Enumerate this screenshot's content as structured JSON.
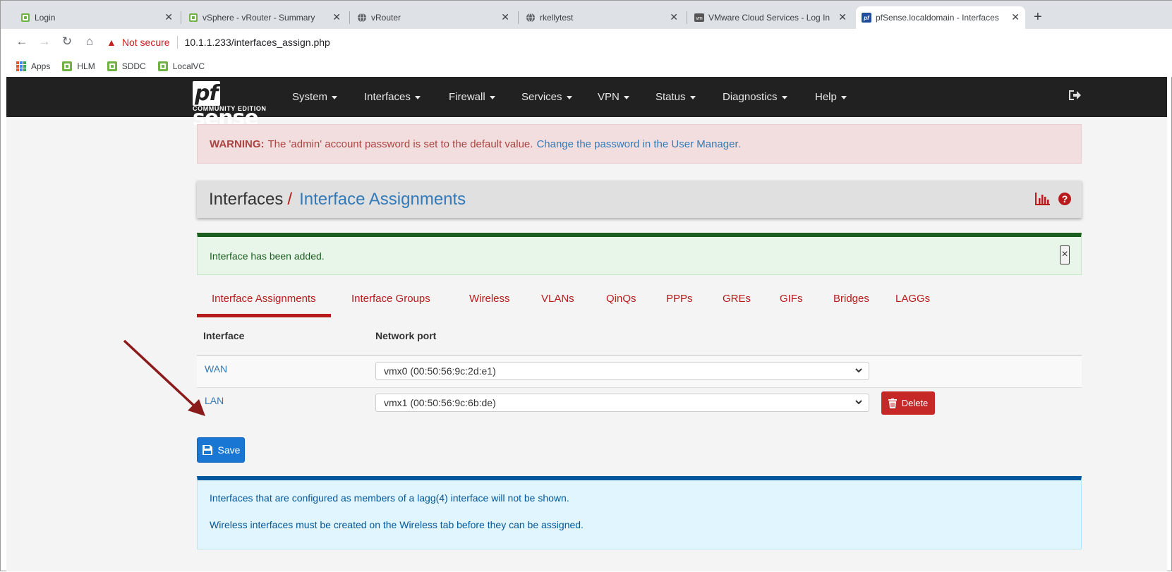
{
  "browser": {
    "tabs": [
      {
        "title": "Login"
      },
      {
        "title": "vSphere - vRouter - Summary"
      },
      {
        "title": "vRouter"
      },
      {
        "title": "rkellytest"
      },
      {
        "title": "VMware Cloud Services - Log In"
      },
      {
        "title": "pfSense.localdomain - Interfaces"
      }
    ],
    "security_label": "Not secure",
    "url": "10.1.1.233/interfaces_assign.php",
    "bookmarks": [
      "Apps",
      "HLM",
      "SDDC",
      "LocalVC"
    ]
  },
  "navbar": {
    "logo_main": "sense",
    "logo_pf": "pf",
    "logo_sub": "COMMUNITY EDITION",
    "menus": [
      "System",
      "Interfaces",
      "Firewall",
      "Services",
      "VPN",
      "Status",
      "Diagnostics",
      "Help"
    ]
  },
  "warning": {
    "label": "WARNING:",
    "text": "The 'admin' account password is set to the default value.",
    "link": "Change the password in the User Manager."
  },
  "page_header": {
    "crumb": "Interfaces",
    "separator": "/",
    "current": "Interface Assignments"
  },
  "success": {
    "message": "Interface has been added.",
    "close": "×"
  },
  "tabs": [
    "Interface Assignments",
    "Interface Groups",
    "Wireless",
    "VLANs",
    "QinQs",
    "PPPs",
    "GREs",
    "GIFs",
    "Bridges",
    "LAGGs"
  ],
  "table": {
    "headers": [
      "Interface",
      "Network port"
    ],
    "rows": [
      {
        "interface": "WAN",
        "port": "vmx0 (00:50:56:9c:2d:e1)"
      },
      {
        "interface": "LAN",
        "port": "vmx1 (00:50:56:9c:6b:de)",
        "action": "Delete"
      }
    ]
  },
  "save_label": "Save",
  "info": {
    "line1": "Interfaces that are configured as members of a lagg(4) interface will not be shown.",
    "line2": "Wireless interfaces must be created on the Wireless tab before they can be assigned."
  },
  "colors": {
    "accent_red": "#b71c1c",
    "link_blue": "#337ab7",
    "navbar_bg": "#212121",
    "save_blue": "#1976d2",
    "delete_red": "#c62828",
    "annotation_arrow": "#8b1a1a"
  }
}
